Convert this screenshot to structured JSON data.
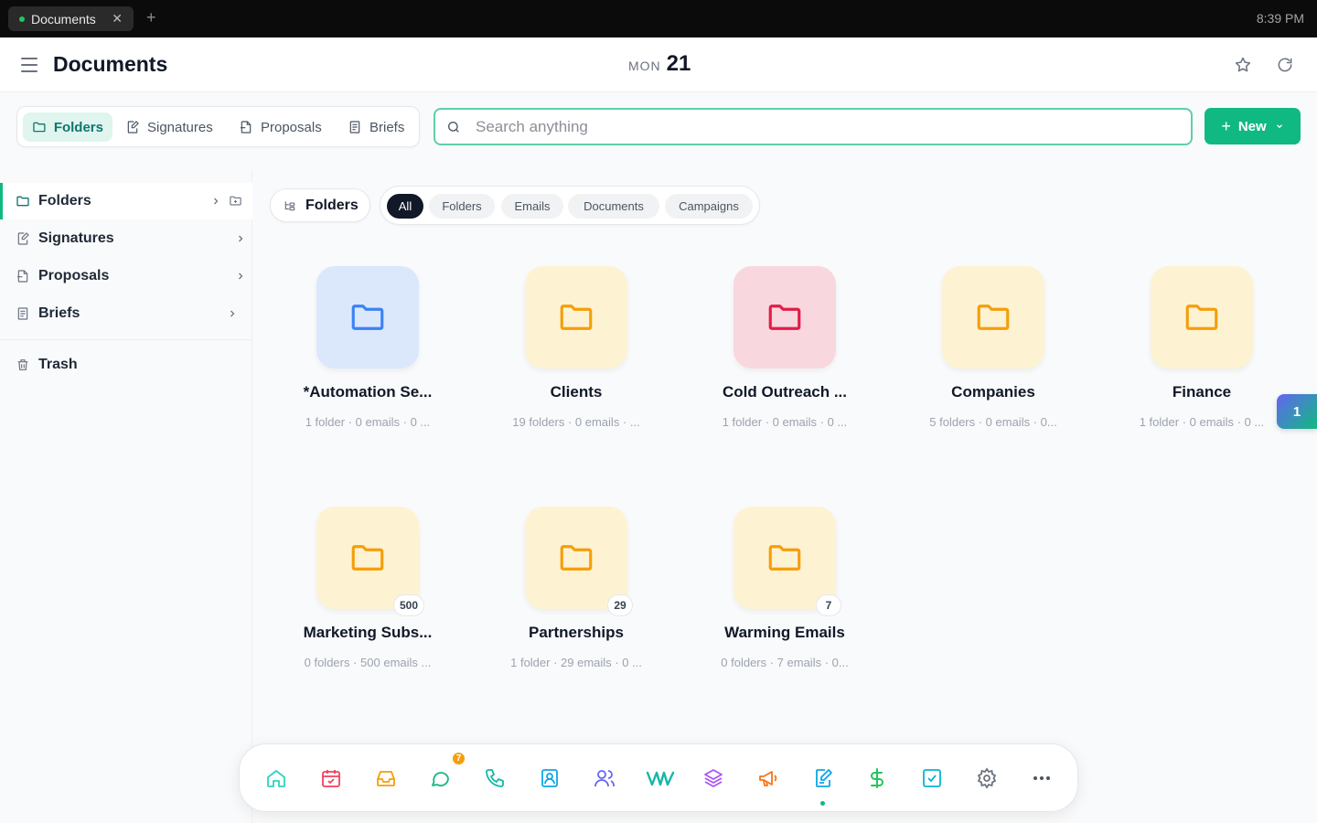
{
  "tabbar": {
    "tab_label": "Documents",
    "clock": "8:39 PM"
  },
  "header": {
    "title": "Documents",
    "day_of_week": "MON",
    "day": "21"
  },
  "top_tabs": [
    {
      "label": "Folders",
      "icon": "folder-icon",
      "active": true
    },
    {
      "label": "Signatures",
      "icon": "signature-icon",
      "active": false
    },
    {
      "label": "Proposals",
      "icon": "proposal-icon",
      "active": false
    },
    {
      "label": "Briefs",
      "icon": "brief-icon",
      "active": false
    }
  ],
  "search": {
    "placeholder": "Search anything",
    "value": ""
  },
  "new_button": {
    "label": "New"
  },
  "sidebar": {
    "items": [
      {
        "label": "Folders",
        "icon": "folder-icon",
        "active": true
      },
      {
        "label": "Signatures",
        "icon": "signature-icon",
        "active": false
      },
      {
        "label": "Proposals",
        "icon": "proposal-icon",
        "active": false
      },
      {
        "label": "Briefs",
        "icon": "brief-icon",
        "active": false
      }
    ],
    "trash_label": "Trash"
  },
  "filters": {
    "section_label": "Folders",
    "pills": [
      {
        "label": "All",
        "active": true
      },
      {
        "label": "Folders",
        "active": false
      },
      {
        "label": "Emails",
        "active": false
      },
      {
        "label": "Documents",
        "active": false
      },
      {
        "label": "Campaigns",
        "active": false
      }
    ]
  },
  "folders": [
    {
      "name": "*Automation Se...",
      "meta": "1 folder · 0 emails · 0 ...",
      "color": "#3b82f6",
      "badge": ""
    },
    {
      "name": "Clients",
      "meta": "19 folders · 0 emails · ...",
      "color": "#f59e0b",
      "badge": ""
    },
    {
      "name": "Cold Outreach ...",
      "meta": "1 folder · 0 emails · 0 ...",
      "color": "#e11d48",
      "badge": ""
    },
    {
      "name": "Companies",
      "meta": "5 folders · 0 emails · 0...",
      "color": "#f59e0b",
      "badge": ""
    },
    {
      "name": "Finance",
      "meta": "1 folder · 0 emails · 0 ...",
      "color": "#f59e0b",
      "badge": ""
    },
    {
      "name": "Marketing Subs...",
      "meta": "0 folders · 500 emails ...",
      "color": "#f59e0b",
      "badge": "500"
    },
    {
      "name": "Partnerships",
      "meta": "1 folder · 29 emails · 0 ...",
      "color": "#f59e0b",
      "badge": "29"
    },
    {
      "name": "Warming Emails",
      "meta": "0 folders · 7 emails · 0...",
      "color": "#f59e0b",
      "badge": "7"
    }
  ],
  "floating_counter": "1",
  "dock": {
    "chat_badge": "7",
    "items": [
      "home-icon",
      "calendar-icon",
      "inbox-icon",
      "chat-icon",
      "phone-icon",
      "contacts-icon",
      "team-icon",
      "waveform-icon",
      "layers-icon",
      "megaphone-icon",
      "document-edit-icon",
      "dollar-icon",
      "task-check-icon",
      "settings-icon",
      "more-icon"
    ]
  },
  "colors": {
    "accent": "#10b981",
    "folder_yellow": "#f59e0b",
    "folder_blue": "#3b82f6",
    "folder_pink": "#e11d48"
  }
}
